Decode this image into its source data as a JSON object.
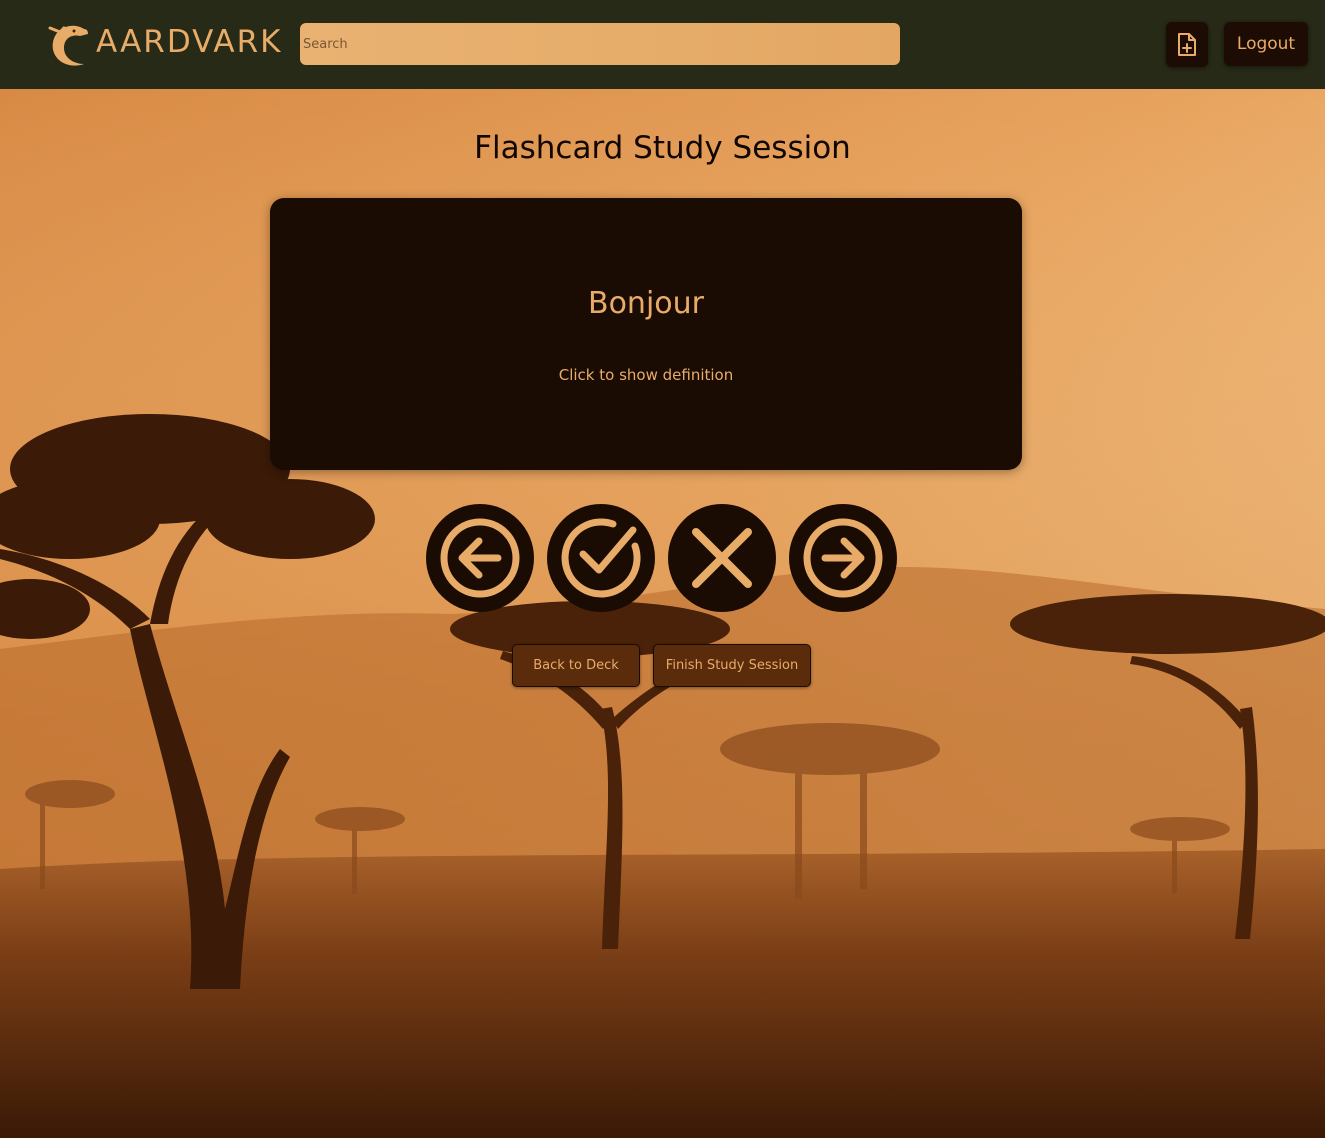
{
  "header": {
    "brand": "AARDVARK",
    "search_placeholder": "Search",
    "logout_label": "Logout"
  },
  "main": {
    "title": "Flashcard Study Session",
    "card": {
      "term": "Bonjour",
      "hint": "Click to show definition"
    },
    "controls": [
      "arrow-left-circle-icon",
      "check-circle-icon",
      "x-icon",
      "arrow-right-circle-icon"
    ],
    "back_label": "Back to Deck",
    "finish_label": "Finish Study Session"
  },
  "colors": {
    "header_bg": "#262a16",
    "accent": "#e8ac68",
    "card_bg": "#1a0b03",
    "button_bg": "#5a2c0b"
  }
}
